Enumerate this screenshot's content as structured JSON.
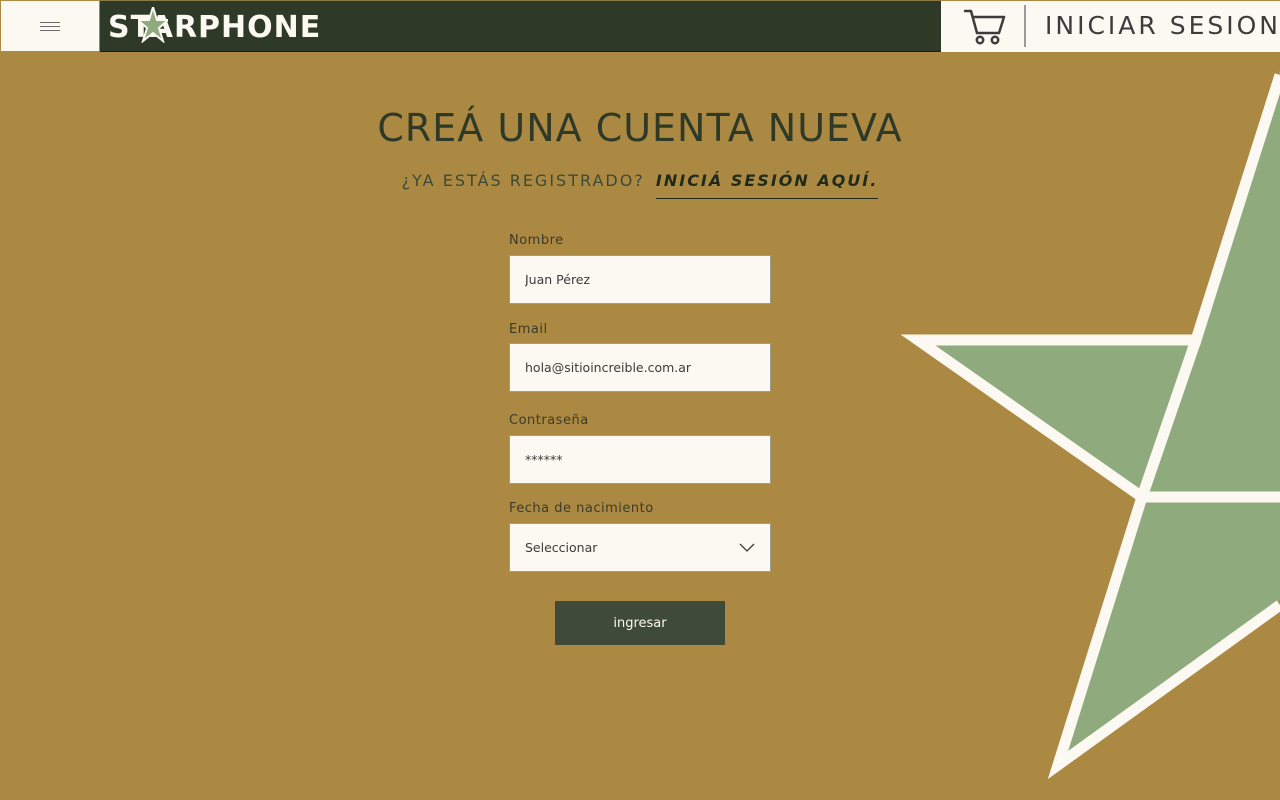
{
  "header": {
    "brand": "STARPHONE",
    "login_label": "INICIAR SESION"
  },
  "form": {
    "title": "CREÁ UNA CUENTA NUEVA",
    "subtitle_prefix": "¿YA ESTÁS REGISTRADO?",
    "subtitle_link": "INICIÁ SESIÓN AQUÍ.",
    "name_label": "Nombre",
    "name_value": "Juan Pérez",
    "email_label": "Email",
    "email_value": "hola@sitioincreible.com.ar",
    "password_label": "Contraseña",
    "password_value": "******",
    "birthdate_label": "Fecha de nacimiento",
    "birthdate_value": "Seleccionar",
    "submit_label": "ingresar"
  },
  "colors": {
    "background": "#AC8942",
    "header_dark": "#2E3A27",
    "cream": "#FCF8F2",
    "star_green": "#8FAA7D",
    "button": "#3F4A3A"
  },
  "icons": {
    "menu": "hamburger-menu-icon",
    "cart": "shopping-cart-icon",
    "dropdown": "chevron-down-icon",
    "decoration": "star-decoration"
  }
}
